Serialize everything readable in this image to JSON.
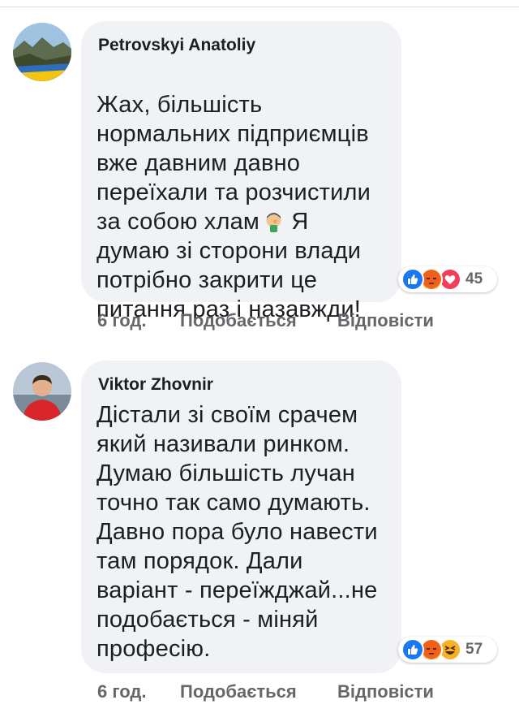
{
  "comments": [
    {
      "author": "Petrovskyi Anatoliy",
      "text_before_emoji": "Жах, більшість\nнормальних підприємців\nвже давним давно\nпереїхали та розчистили\nза собою хлам",
      "emoji": "face-palm-emoji",
      "text_after_emoji": " Я\nдумаю зі сторони влади\nпотрібно закрити це\nпитання раз і назавжди!",
      "reactions": [
        "like",
        "angry",
        "love"
      ],
      "reaction_count": "45",
      "time": "6 год.",
      "like_label": "Подобається",
      "reply_label": "Відповісти"
    },
    {
      "author": "Viktor Zhovnir",
      "text": "Дістали зі своїм срачем\nякий називали ринком.\nДумаю більшість лучан\nточно так само думають.\nДавно пора було навести\nтам порядок. Дали\nваріант - переїжджай...не\nподобається - міняй\nпрофесію.",
      "reactions": [
        "like",
        "angry",
        "haha"
      ],
      "reaction_count": "57",
      "time": "6 год.",
      "like_label": "Подобається",
      "reply_label": "Відповісти"
    }
  ],
  "colors": {
    "like": "#1877f2",
    "angry": "#e9710f",
    "love": "#f33e58",
    "haha": "#f7b125",
    "bubble": "#f0f2f5",
    "meta_text": "#65676b"
  }
}
